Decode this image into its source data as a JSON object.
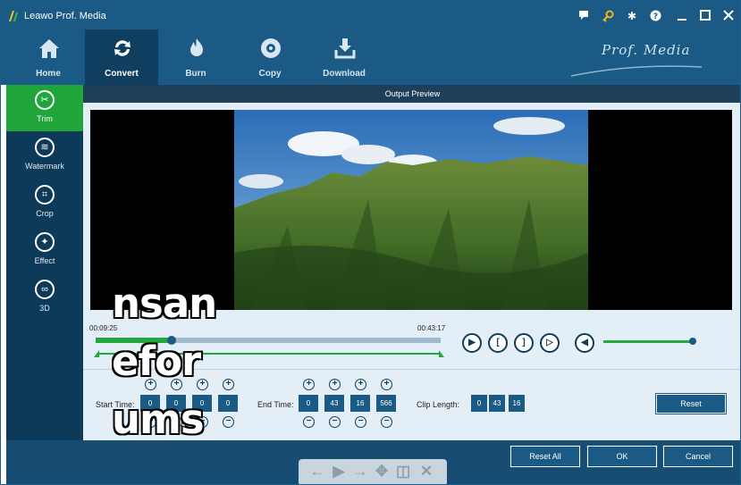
{
  "window": {
    "title": "Leawo Prof. Media",
    "brand": "Prof. Media"
  },
  "titlebar_icons": [
    "chat-icon",
    "key-icon",
    "gear-icon",
    "help-icon",
    "minimize-icon",
    "maximize-icon",
    "close-icon"
  ],
  "nav": [
    {
      "label": "Home",
      "icon": "home-icon"
    },
    {
      "label": "Convert",
      "icon": "convert-icon",
      "active": true
    },
    {
      "label": "Burn",
      "icon": "burn-icon"
    },
    {
      "label": "Copy",
      "icon": "copy-icon"
    },
    {
      "label": "Download",
      "icon": "download-icon"
    }
  ],
  "sidebar": [
    {
      "label": "Trim",
      "icon": "scissors-icon",
      "active": true
    },
    {
      "label": "Watermark",
      "icon": "watermark-icon"
    },
    {
      "label": "Crop",
      "icon": "crop-icon"
    },
    {
      "label": "Effect",
      "icon": "effect-icon"
    },
    {
      "label": "3D",
      "icon": "3d-glasses-icon"
    }
  ],
  "preview": {
    "title": "Output Preview",
    "time_start": "00:09:25",
    "time_end": "00:43:17",
    "progress_fraction": 0.22,
    "volume_fraction": 1.0
  },
  "trim": {
    "start_label": "Start Time:",
    "start_values": [
      "0",
      "0",
      "0",
      "0"
    ],
    "end_label": "End Time:",
    "end_values": [
      "0",
      "43",
      "16",
      "566"
    ],
    "clip_label": "Clip Length:",
    "clip_values": [
      "0",
      "43",
      "16"
    ],
    "reset_label": "Reset"
  },
  "buttons": {
    "reset_all": "Reset All",
    "ok": "OK",
    "cancel": "Cancel"
  },
  "overlay_text": [
    "nsan",
    "efor",
    "ums"
  ],
  "colors": {
    "titlebar": "#1a5a84",
    "accent_green": "#22a83e",
    "sidebar": "#0e3a59"
  }
}
